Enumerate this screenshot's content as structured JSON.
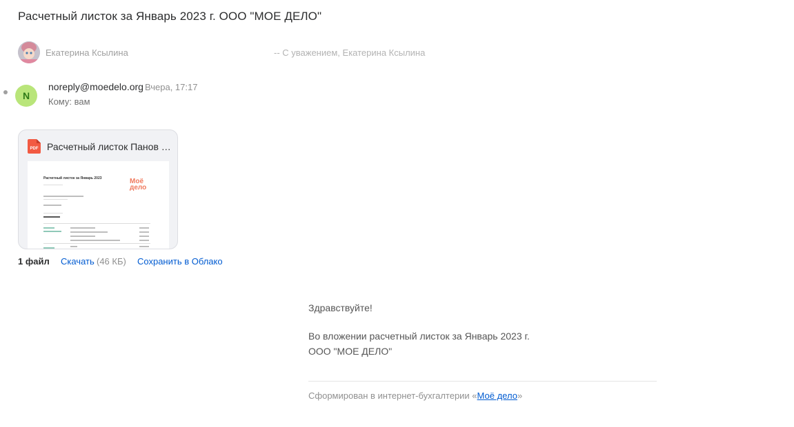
{
  "subject": "Расчетный листок за Январь 2023 г. ООО \"МОЕ ДЕЛО\"",
  "thread": {
    "name": "Екатерина Ксылина",
    "snippet": "-- С уважением, Екатерина Ксылина"
  },
  "message": {
    "avatar_letter": "N",
    "sender": "noreply@moedelo.org",
    "time": "Вчера, 17:17",
    "recipient": "Кому: вам"
  },
  "attachment": {
    "type_label": "PDF",
    "name": "Расчетный листок Панов С...",
    "preview_title": "Расчетный листок за Январь 2023",
    "preview_logo": "Моё\nдело"
  },
  "files_bar": {
    "count": "1 файл",
    "download": "Скачать",
    "size": "(46 КБ)",
    "cloud": "Сохранить в Облако"
  },
  "body": {
    "greeting": "Здравствуйте!",
    "line1": "Во вложении расчетный листок за Январь 2023 г.",
    "line2": "ООО \"МОЕ ДЕЛО\""
  },
  "footer": {
    "prefix": "Сформирован в интернет-бухгалтерии «",
    "link": "Моё дело",
    "suffix": "»"
  },
  "colors": {
    "link": "#005bd1",
    "avatar_bg": "#b9e57a",
    "pdf_icon": "#f25a42"
  }
}
